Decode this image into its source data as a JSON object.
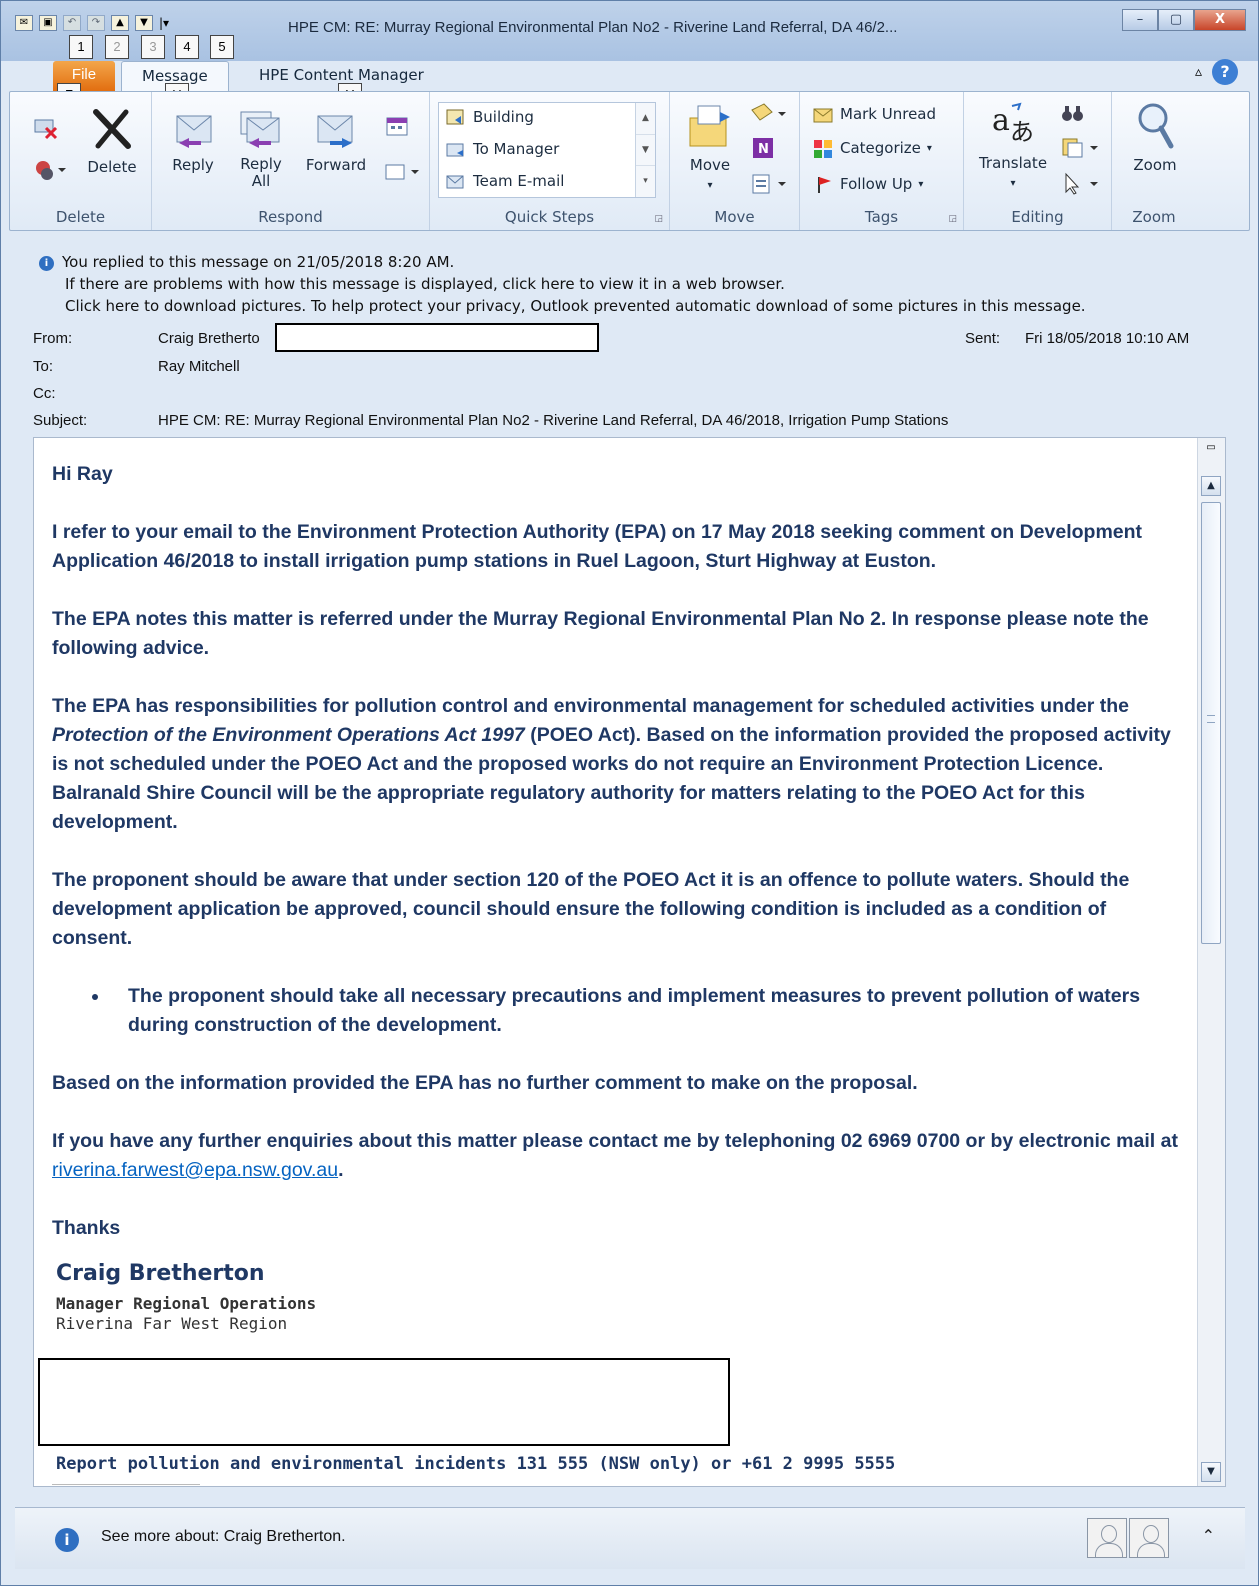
{
  "window": {
    "title": "HPE CM: RE: Murray Regional Environmental Plan No2 - Riverine Land Referral, DA 46/2...",
    "minimize": "–",
    "maximize": "▢",
    "close": "X"
  },
  "keytips": [
    "1",
    "2",
    "3",
    "4",
    "5",
    "F",
    "H",
    "Y"
  ],
  "tabs": {
    "file": "File",
    "message": "Message",
    "hpe": "HPE Content Manager"
  },
  "ribbon": {
    "delete_group": {
      "label": "Delete",
      "delete": "Delete"
    },
    "respond_group": {
      "label": "Respond",
      "reply": "Reply",
      "reply_all_1": "Reply",
      "reply_all_2": "All",
      "forward": "Forward"
    },
    "quick_steps": {
      "label": "Quick Steps",
      "items": [
        "Building",
        "To Manager",
        "Team E-mail"
      ]
    },
    "move_group": {
      "label": "Move",
      "move": "Move"
    },
    "tags_group": {
      "label": "Tags",
      "mark_unread": "Mark Unread",
      "categorize": "Categorize",
      "follow_up": "Follow Up"
    },
    "editing_group": {
      "label": "Editing",
      "translate": "Translate"
    },
    "zoom_group": {
      "label": "Zoom",
      "zoom": "Zoom"
    }
  },
  "info": {
    "line1": "You replied to this message on 21/05/2018 8:20 AM.",
    "line2": "If there are problems with how this message is displayed, click here to view it in a web browser.",
    "line3": "Click here to download pictures. To help protect your privacy, Outlook prevented automatic download of some pictures in this message."
  },
  "header": {
    "from_label": "From:",
    "from_value": "Craig Bretherto",
    "to_label": "To:",
    "to_value": "Ray Mitchell",
    "cc_label": "Cc:",
    "subject_label": "Subject:",
    "subject_value": "HPE CM: RE: Murray Regional Environmental Plan No2 - Riverine Land Referral, DA 46/2018, Irrigation Pump Stations",
    "sent_label": "Sent:",
    "sent_value": "Fri 18/05/2018 10:10 AM"
  },
  "body": {
    "greeting": "Hi Ray",
    "p1": "I refer to your email to the Environment Protection Authority (EPA) on 17 May 2018 seeking comment on Development Application 46/2018 to install irrigation pump stations in Ruel Lagoon, Sturt Highway at Euston.",
    "p2": "The EPA notes this matter is referred under the Murray Regional Environmental Plan No 2. In response please note the following advice.",
    "p3_a": "The EPA has responsibilities for pollution control and environmental management for scheduled activities under the ",
    "p3_italic": "Protection of the Environment Operations Act 1997",
    "p3_b": " (POEO Act). Based on the information provided the proposed activity is not scheduled under the POEO Act and the proposed works do not require an Environment Protection Licence. Balranald Shire Council will be the appropriate regulatory authority for matters relating to the POEO Act for this development.",
    "p4": "The proponent should be aware that under section 120 of the POEO Act it is an offence to pollute waters. Should the development application be approved, council should ensure the following condition is included as a condition of consent.",
    "bullet": "The proponent should take all necessary precautions and implement measures to prevent pollution of waters during construction of the development.",
    "p5": "Based on the information provided the EPA has no further comment to make on the proposal.",
    "p6_a": "If you have any further enquiries about this matter please contact me by telephoning 02 6969 0700 or by electronic mail at ",
    "p6_link": "riverina.farwest@epa.nsw.gov.au",
    "p6_b": ".",
    "thanks": "Thanks",
    "sig_name": "Craig Bretherton",
    "sig_title": "Manager Regional Operations",
    "sig_region": "Riverina Far West Region",
    "report": "Report pollution and environmental incidents 131 555 (NSW only) or +61 2 9995 5555"
  },
  "people_bar": {
    "text": "See more about: Craig Bretherton."
  },
  "colors": {
    "body_text": "#1f3864",
    "link": "#0563c1",
    "file_tab": "#e26e10"
  }
}
